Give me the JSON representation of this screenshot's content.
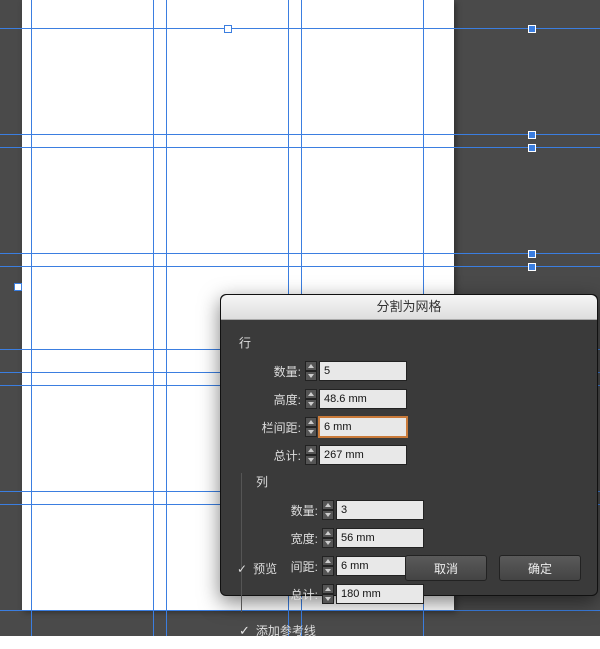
{
  "dialog": {
    "title": "分割为网格",
    "groups": {
      "rows": {
        "title": "行",
        "count_label": "数量:",
        "count_value": "5",
        "height_label": "高度:",
        "height_value": "48.6 mm",
        "gutter_label": "栏间距:",
        "gutter_value": "6 mm",
        "total_label": "总计:",
        "total_value": "267 mm"
      },
      "cols": {
        "title": "列",
        "count_label": "数量:",
        "count_value": "3",
        "width_label": "宽度:",
        "width_value": "56 mm",
        "gutter_label": "间距:",
        "gutter_value": "6 mm",
        "total_label": "总计:",
        "total_value": "180 mm"
      }
    },
    "add_guides_label": "添加参考线",
    "preview_label": "预览",
    "cancel_label": "取消",
    "ok_label": "确定"
  }
}
